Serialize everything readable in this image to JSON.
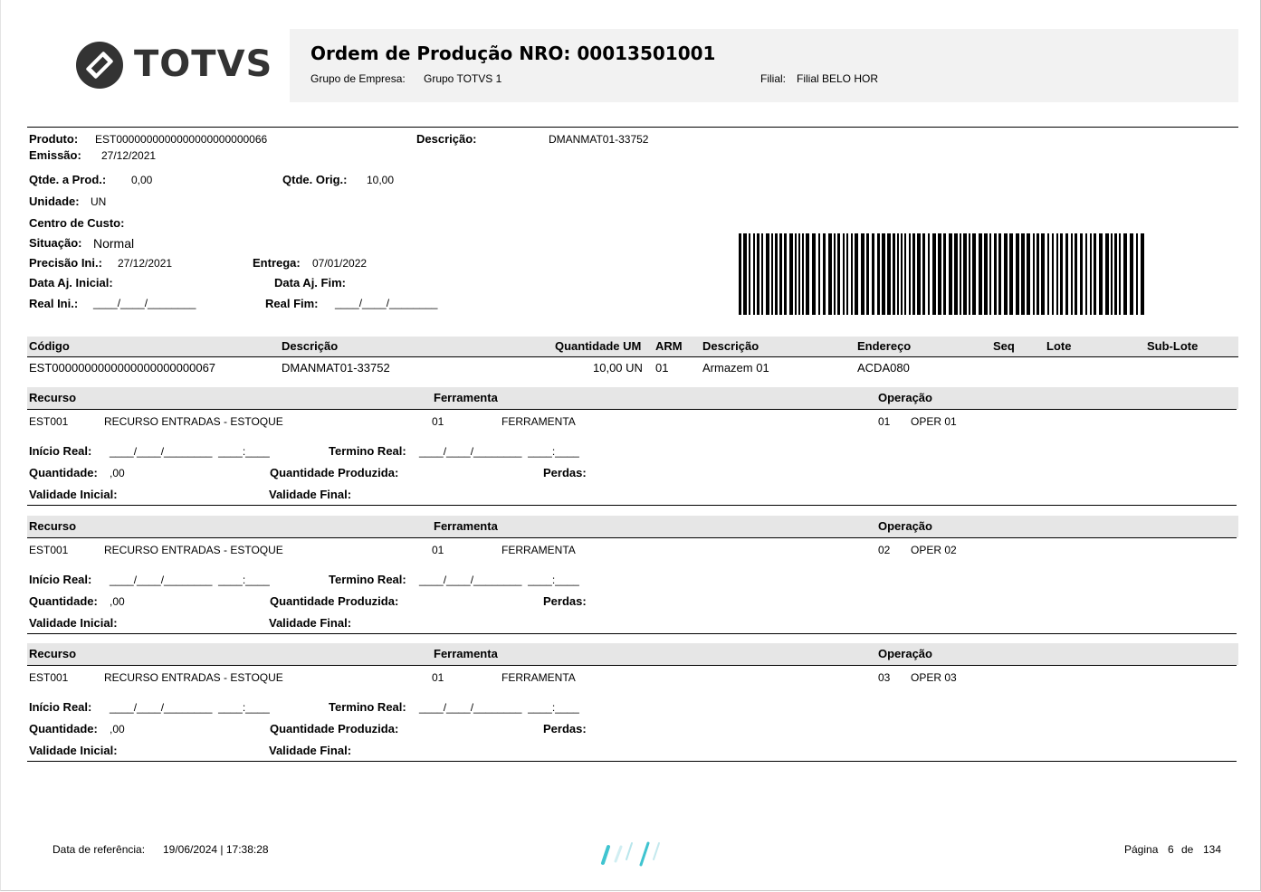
{
  "header": {
    "logo_text": "TOTVS",
    "title": "Ordem de Produção NRO: 00013501001",
    "grupo_label": "Grupo de Empresa:",
    "grupo_value": "Grupo TOTVS 1",
    "filial_label": "Filial:",
    "filial_value": "Filial BELO HOR"
  },
  "info": {
    "produto_label": "Produto:",
    "produto_value": "EST0000000000000000000000066",
    "descricao_label": "Descrição:",
    "descricao_value": "DMANMAT01-33752",
    "emissao_label": "Emissão:",
    "emissao_value": "27/12/2021",
    "qtde_prod_label": "Qtde. a Prod.:",
    "qtde_prod_value": "0,00",
    "qtde_orig_label": "Qtde. Orig.:",
    "qtde_orig_value": "10,00",
    "unidade_label": "Unidade:",
    "unidade_value": "UN",
    "centro_label": "Centro de Custo:",
    "situacao_label": "Situação:",
    "situacao_value": "Normal",
    "precisao_label": "Precisão Ini.:",
    "precisao_value": "27/12/2021",
    "entrega_label": "Entrega:",
    "entrega_value": "07/01/2022",
    "data_aj_ini_label": "Data Aj. Inicial:",
    "data_aj_fim_label": "Data Aj. Fim:",
    "real_ini_label": "Real Ini.:",
    "real_ini_blank": "____/____/________",
    "real_fim_label": "Real Fim:",
    "real_fim_blank": "____/____/________"
  },
  "components": {
    "headers": [
      "Código",
      "Descrição",
      "Quantidade UM",
      "ARM",
      "Descrição",
      "Endereço",
      "Seq",
      "Lote",
      "Sub-Lote"
    ],
    "row": {
      "codigo": "EST0000000000000000000000067",
      "descricao": "DMANMAT01-33752",
      "quantidade": "10,00 UN",
      "arm": "01",
      "arm_desc": "Armazem 01",
      "endereco": "ACDA080"
    }
  },
  "operations": [
    {
      "recurso_h": "Recurso",
      "ferramenta_h": "Ferramenta",
      "operacao_h": "Operação",
      "recurso_code": "EST001",
      "recurso_desc": "RECURSO ENTRADAS - ESTOQUE",
      "ferramenta_code": "01",
      "ferramenta_desc": "FERRAMENTA",
      "operacao_code": "01",
      "operacao_desc": "OPER 01",
      "inicio_label": "Início Real:",
      "inicio_blank": "____/____/________  ____:____",
      "termino_label": "Termino Real:",
      "termino_blank": "____/____/________  ____:____",
      "quantidade_label": "Quantidade:",
      "quantidade_value": ",00",
      "qtd_prod_label": "Quantidade Produzida:",
      "perdas_label": "Perdas:",
      "val_ini_label": "Validade Inicial:",
      "val_fim_label": "Validade Final:"
    },
    {
      "recurso_h": "Recurso",
      "ferramenta_h": "Ferramenta",
      "operacao_h": "Operação",
      "recurso_code": "EST001",
      "recurso_desc": "RECURSO ENTRADAS - ESTOQUE",
      "ferramenta_code": "01",
      "ferramenta_desc": "FERRAMENTA",
      "operacao_code": "02",
      "operacao_desc": "OPER 02",
      "inicio_label": "Início Real:",
      "inicio_blank": "____/____/________  ____:____",
      "termino_label": "Termino Real:",
      "termino_blank": "____/____/________  ____:____",
      "quantidade_label": "Quantidade:",
      "quantidade_value": ",00",
      "qtd_prod_label": "Quantidade Produzida:",
      "perdas_label": "Perdas:",
      "val_ini_label": "Validade Inicial:",
      "val_fim_label": "Validade Final:"
    },
    {
      "recurso_h": "Recurso",
      "ferramenta_h": "Ferramenta",
      "operacao_h": "Operação",
      "recurso_code": "EST001",
      "recurso_desc": "RECURSO ENTRADAS - ESTOQUE",
      "ferramenta_code": "01",
      "ferramenta_desc": "FERRAMENTA",
      "operacao_code": "03",
      "operacao_desc": "OPER 03",
      "inicio_label": "Início Real:",
      "inicio_blank": "____/____/________  ____:____",
      "termino_label": "Termino Real:",
      "termino_blank": "____/____/________  ____:____",
      "quantidade_label": "Quantidade:",
      "quantidade_value": ",00",
      "qtd_prod_label": "Quantidade Produzida:",
      "perdas_label": "Perdas:",
      "val_ini_label": "Validade Inicial:",
      "val_fim_label": "Validade Final:"
    }
  ],
  "footer": {
    "ref_label": "Data de referência:",
    "ref_value": "19/06/2024 | 17:38:28",
    "page_label": "Página",
    "page_current": "6",
    "page_of": "de",
    "page_total": "134"
  },
  "colors": {
    "band": "#e6e6e6",
    "header_box": "#f2f2f2",
    "accent": "#40c4d0"
  },
  "icons": [
    "totvs-logo-icon",
    "barcode-icon",
    "totvs-footer-mark-icon"
  ]
}
